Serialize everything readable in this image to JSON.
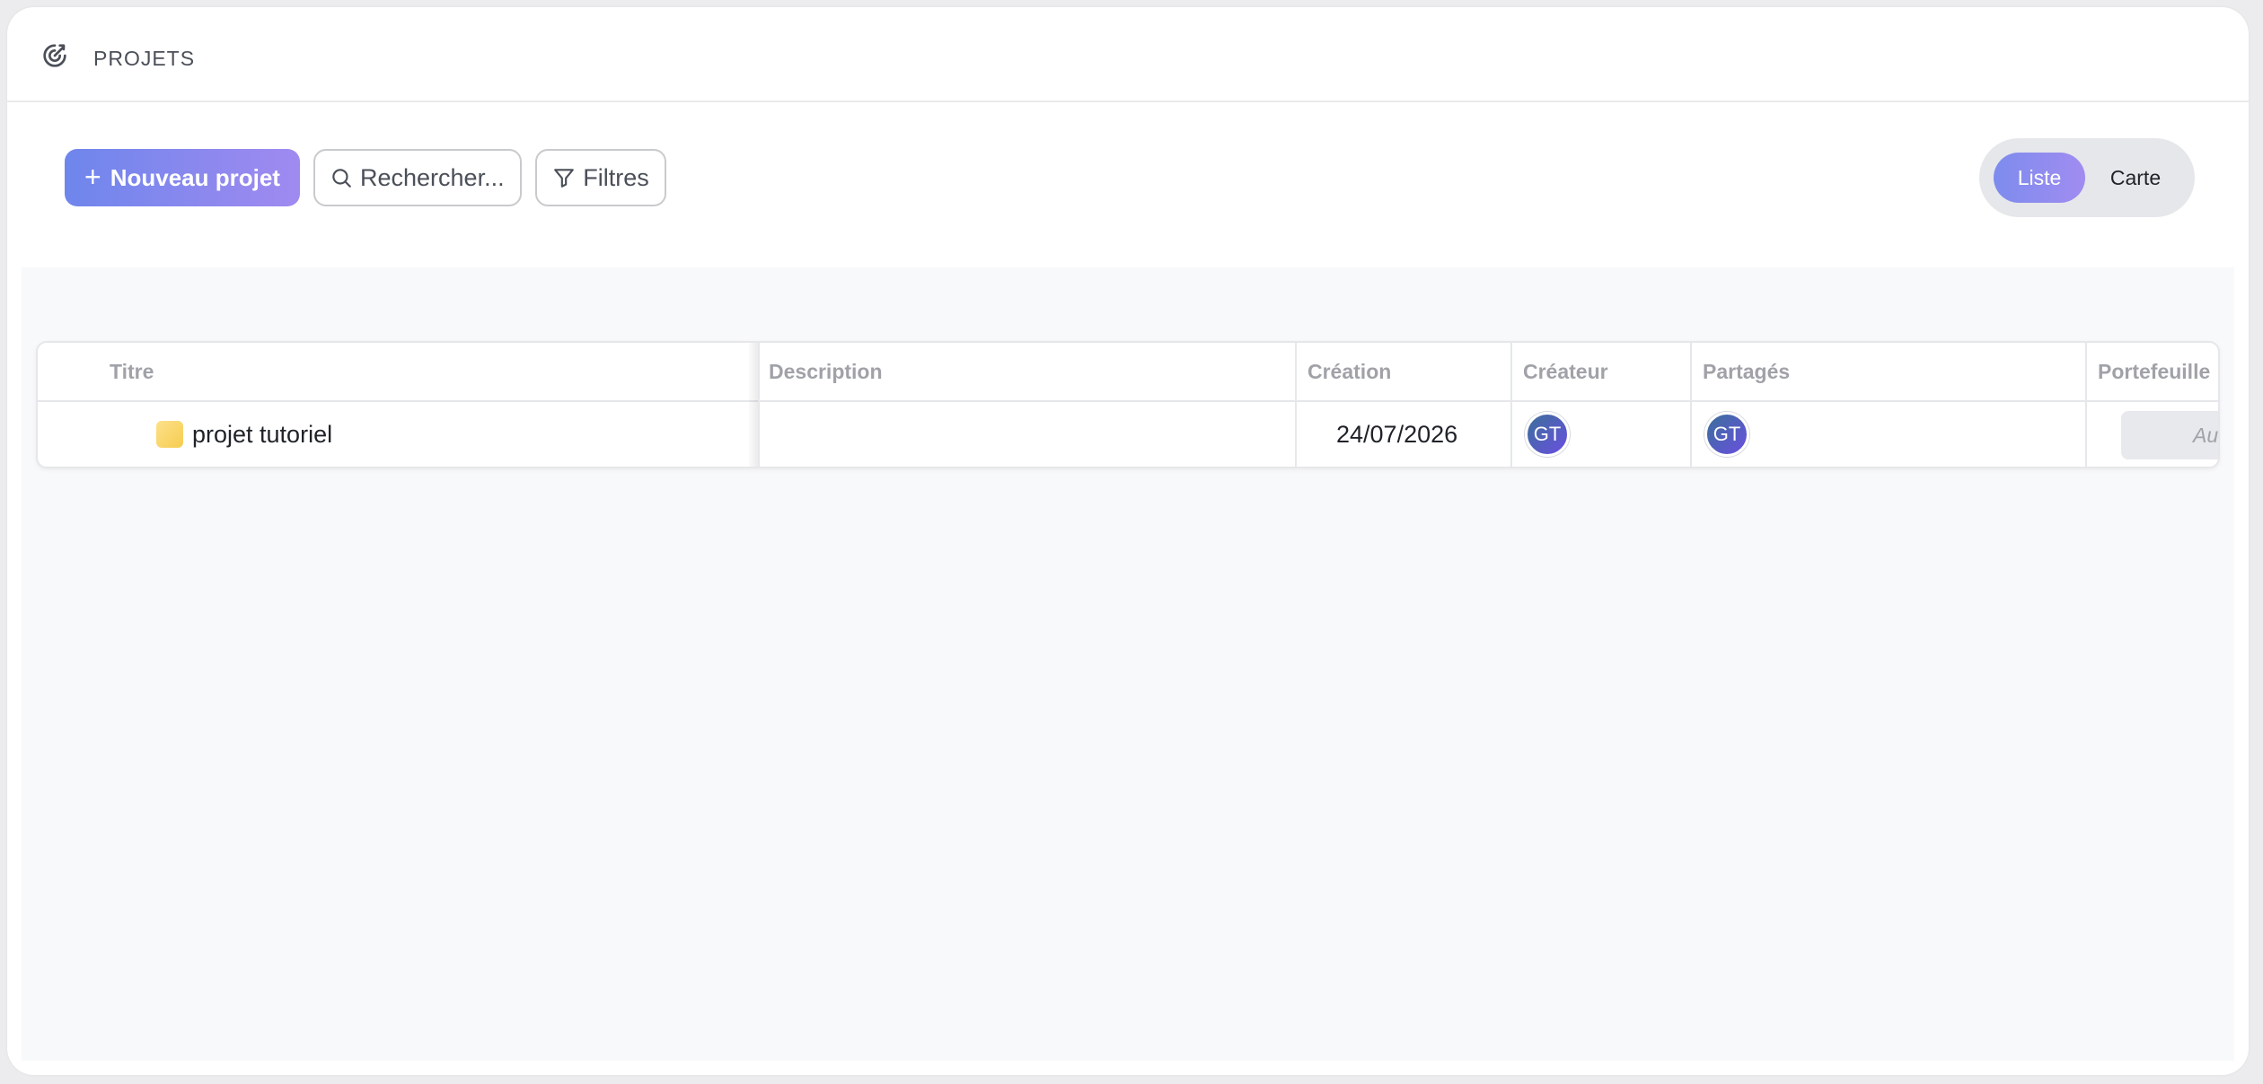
{
  "header": {
    "title": "PROJETS",
    "logo_icon": "target-icon"
  },
  "toolbar": {
    "new_project_label": "Nouveau projet",
    "search_placeholder": "Rechercher...",
    "filters_label": "Filtres",
    "view_toggle": {
      "options": [
        "Liste",
        "Carte"
      ],
      "selected": "Liste"
    }
  },
  "table": {
    "columns": [
      "Titre",
      "Description",
      "Création",
      "Créateur",
      "Partagés",
      "Portefeuille"
    ],
    "rows": [
      {
        "title": "projet tutoriel",
        "description": "",
        "created": "24/07/2026",
        "creator_initials": "GT",
        "shared_initials": "GT",
        "portfolio": "Aucun"
      }
    ]
  },
  "colors": {
    "accent_start": "#6e86ec",
    "accent_end": "#a08af0",
    "project_color": "#f6cd50"
  }
}
